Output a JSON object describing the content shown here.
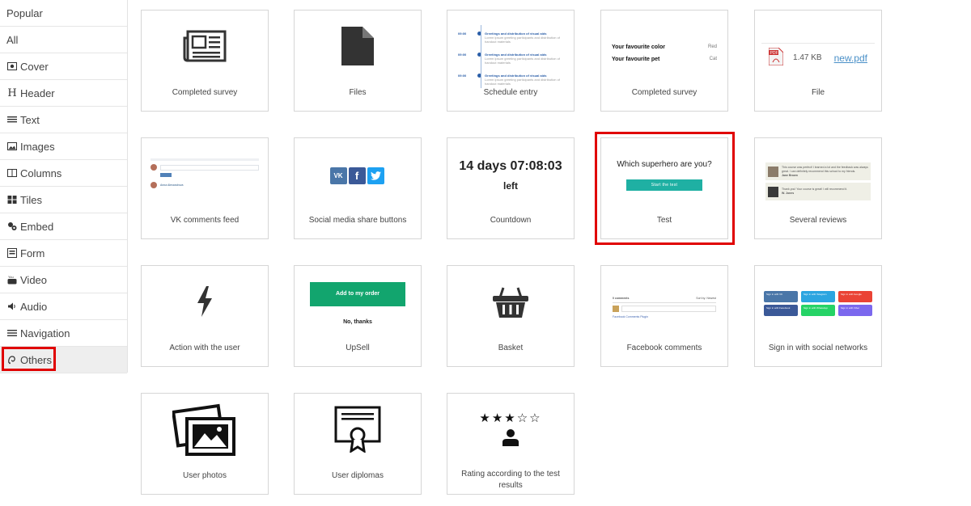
{
  "sidebar": {
    "items": [
      {
        "label": "Popular",
        "icon": ""
      },
      {
        "label": "All",
        "icon": ""
      },
      {
        "label": "Cover",
        "icon": "cover-icon"
      },
      {
        "label": "Header",
        "icon": "header-icon"
      },
      {
        "label": "Text",
        "icon": "text-icon"
      },
      {
        "label": "Images",
        "icon": "image-icon"
      },
      {
        "label": "Columns",
        "icon": "columns-icon"
      },
      {
        "label": "Tiles",
        "icon": "tiles-icon"
      },
      {
        "label": "Embed",
        "icon": "embed-icon"
      },
      {
        "label": "Form",
        "icon": "form-icon"
      },
      {
        "label": "Video",
        "icon": "youtube-icon"
      },
      {
        "label": "Audio",
        "icon": "audio-icon"
      },
      {
        "label": "Navigation",
        "icon": "menu-icon"
      },
      {
        "label": "Others",
        "icon": "others-icon"
      }
    ],
    "active": "Others"
  },
  "tiles": {
    "completed_survey_1": {
      "label": "Completed survey"
    },
    "files": {
      "label": "Files"
    },
    "schedule_entry": {
      "label": "Schedule entry",
      "rows": [
        {
          "time": "09:00",
          "title": "Greetings and distribution of visual aids",
          "desc": "Lorem ipsum greeting participants and distribution of handout materials"
        },
        {
          "time": "09:00",
          "title": "Greetings and distribution of visual aids",
          "desc": "Lorem ipsum greeting participants and distribution of handout materials"
        },
        {
          "time": "09:00",
          "title": "Greetings and distribution of visual aids",
          "desc": "Lorem ipsum greeting participants and distribution of handout materials"
        }
      ]
    },
    "completed_survey_2": {
      "label": "Completed survey",
      "rows": [
        {
          "question": "Your favourite color",
          "answer": "Red"
        },
        {
          "question": "Your favourite pet",
          "answer": "Cat"
        }
      ]
    },
    "file": {
      "label": "File",
      "size": "1.47 KB",
      "filename": "new.pdf",
      "badge": "PDF"
    },
    "vk_comments": {
      "label": "VK comments feed",
      "author": "Anna Alexandrova",
      "button": "Publish"
    },
    "social_share": {
      "label": "Social media share buttons",
      "vk": "VK",
      "fb": "f"
    },
    "countdown": {
      "label": "Countdown",
      "time": "14 days 07:08:03",
      "suffix": "left"
    },
    "test": {
      "label": "Test",
      "question": "Which superhero are you?",
      "button": "Start the test"
    },
    "reviews": {
      "label": "Several reviews",
      "items": [
        {
          "text": "This course was perfect! I learned a lot and the feedback was always great. I can definitely recommend this school to my friends.",
          "author": "Jane Brown"
        },
        {
          "text": "Thank you! Your course is great! I will recommend it.",
          "author": "W. Jones"
        }
      ]
    },
    "action_user": {
      "label": "Action with the user"
    },
    "upsell": {
      "label": "UpSell",
      "button": "Add to my order",
      "decline": "No, thanks"
    },
    "basket": {
      "label": "Basket"
    },
    "facebook_comments": {
      "label": "Facebook comments",
      "count": "0 comments",
      "sort": "Sort by: Newest",
      "hint": "Facebook Comments Plugin"
    },
    "signin": {
      "label": "Sign in with social networks",
      "buttons": [
        "Sign in with VK",
        "Sign in with Telegram",
        "Sign in with Google",
        "Sign in with Facebook",
        "Sign in with WhatsApp",
        "Sign in with Viber"
      ]
    },
    "user_photos": {
      "label": "User photos"
    },
    "user_diplomas": {
      "label": "User diplomas"
    },
    "rating": {
      "label": "Rating according to the test results",
      "stars_filled": 3,
      "stars_total": 5
    }
  },
  "colors": {
    "highlight": "#e00000",
    "schedule_blue": "#2a5ea8",
    "test_teal": "#1fb0a3",
    "upsell_green": "#12a56e",
    "vk_blue": "#4a76a8",
    "fb_blue": "#3b5998",
    "twitter_blue": "#1da1f2"
  }
}
